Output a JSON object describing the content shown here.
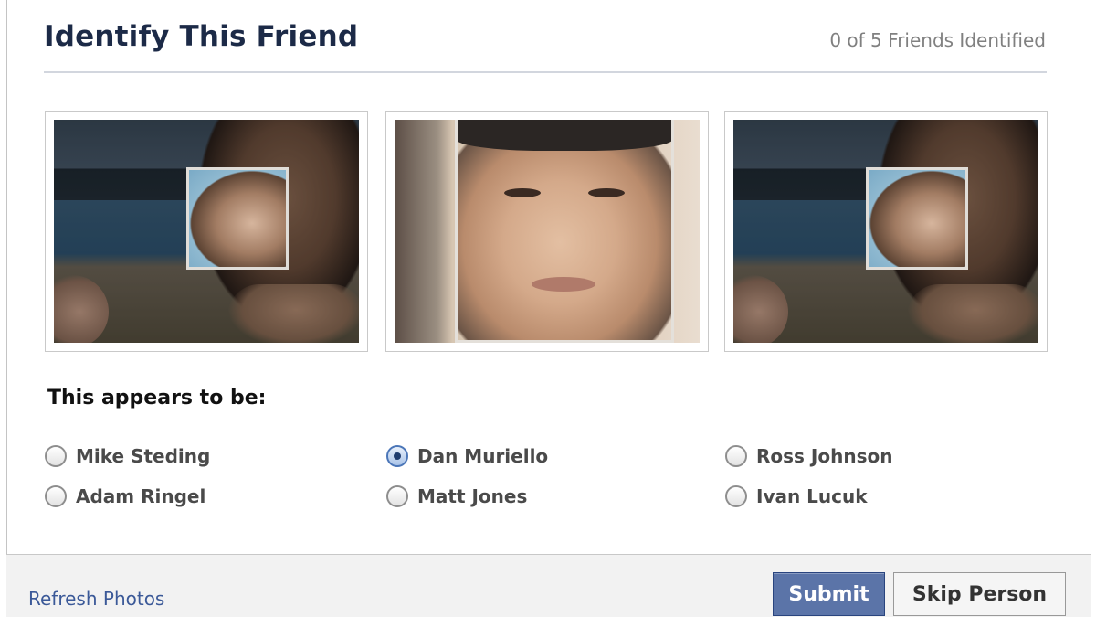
{
  "header": {
    "title": "Identify This Friend",
    "counter": "0 of 5 Friends Identified"
  },
  "photos": [
    {
      "name": "photo-1"
    },
    {
      "name": "photo-2"
    },
    {
      "name": "photo-3"
    }
  ],
  "question": {
    "prompt": "This appears to be:"
  },
  "options": [
    {
      "label": "Mike Steding",
      "checked": false
    },
    {
      "label": "Dan Muriello",
      "checked": true
    },
    {
      "label": "Ross Johnson",
      "checked": false
    },
    {
      "label": "Adam Ringel",
      "checked": false
    },
    {
      "label": "Matt Jones",
      "checked": false
    },
    {
      "label": "Ivan Lucuk",
      "checked": false
    }
  ],
  "footer": {
    "refresh_label": "Refresh Photos",
    "submit_label": "Submit",
    "skip_label": "Skip Person"
  },
  "colors": {
    "accent": "#3b5998",
    "submit_bg": "#5b74a8",
    "title": "#1c2a47"
  }
}
